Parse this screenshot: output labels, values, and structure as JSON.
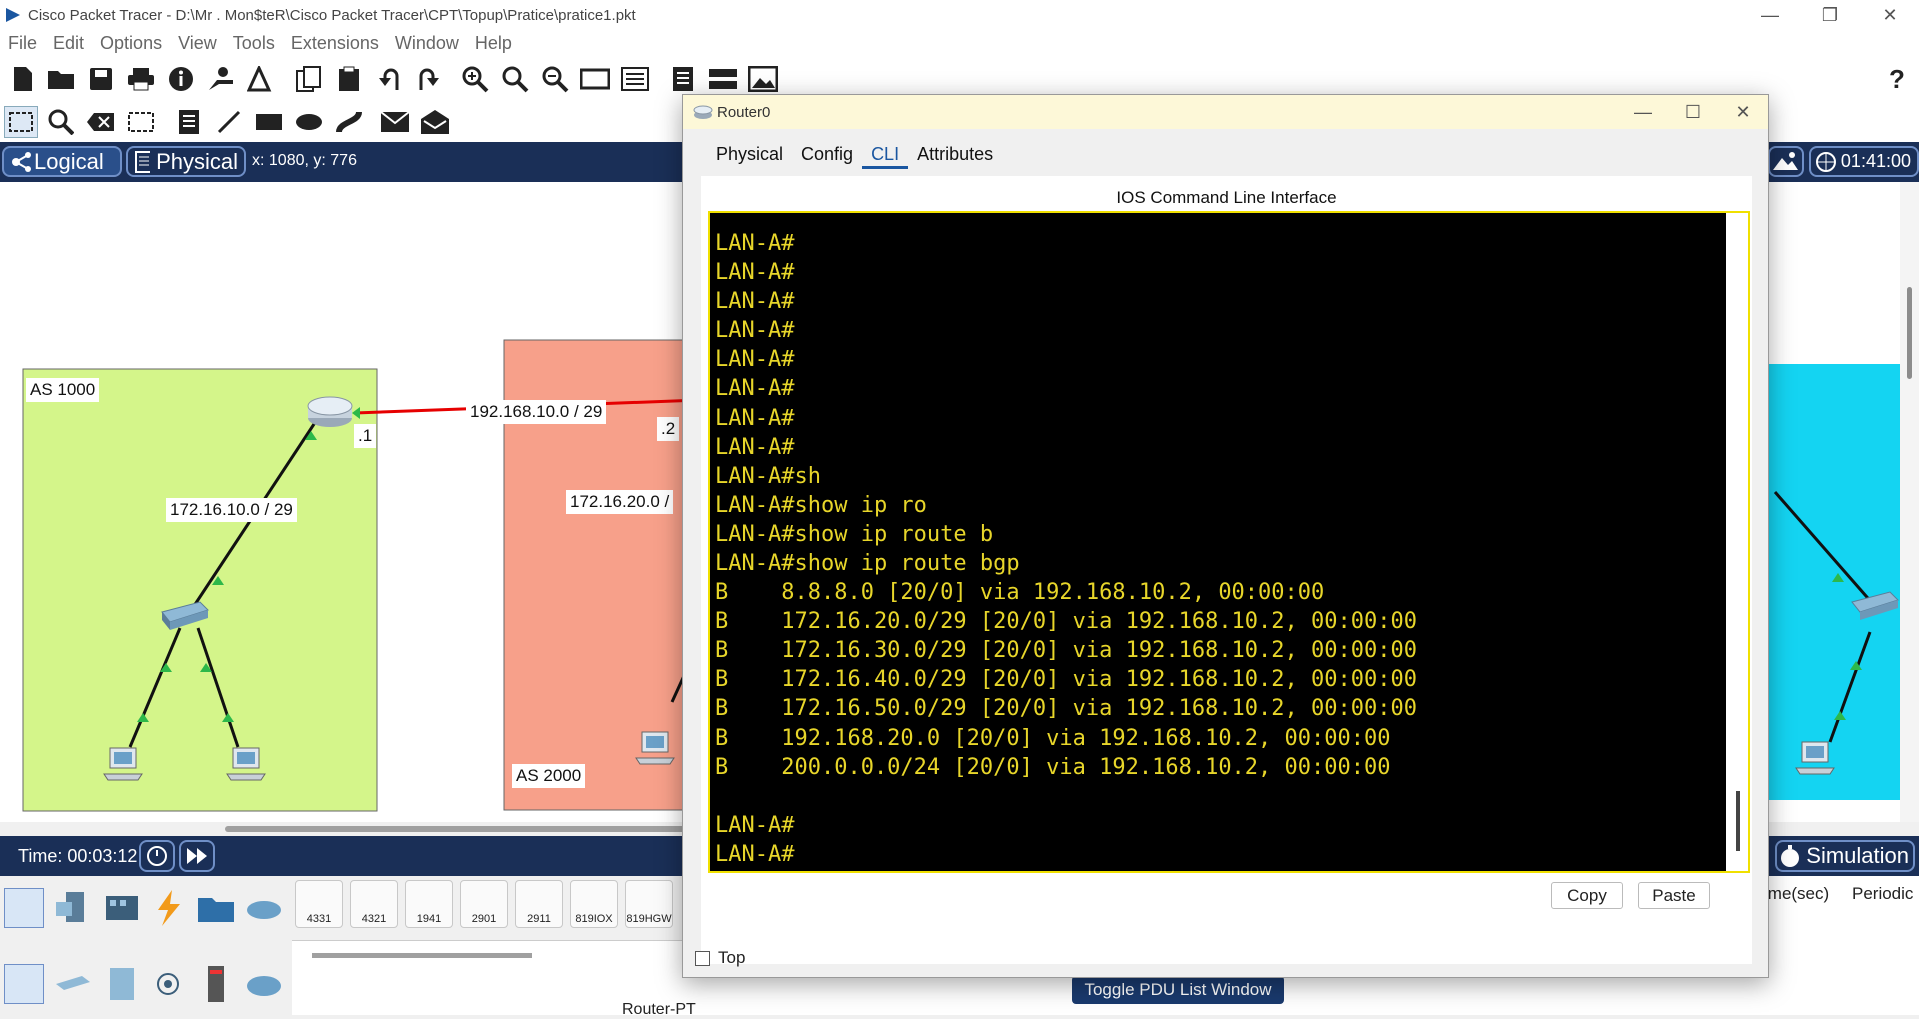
{
  "app": {
    "title": "Cisco Packet Tracer - D:\\Mr . Mon$teR\\Cisco Packet Tracer\\CPT\\Topup\\Pratice\\pratice1.pkt"
  },
  "menu": [
    "File",
    "Edit",
    "Options",
    "View",
    "Tools",
    "Extensions",
    "Window",
    "Help"
  ],
  "viewbar": {
    "logical": "Logical",
    "physical": "Physical",
    "coords": "x: 1080, y: 776",
    "clock": "01:41:00"
  },
  "topology": {
    "as1000": "AS 1000",
    "as2000": "AS 2000",
    "link_wan": "192.168.10.0 / 29",
    "link_lan_a": "172.16.10.0 / 29",
    "link_lan_b": "172.16.20.0 /",
    "ip_r0": ".1",
    "ip_r1": ".2",
    "colors": {
      "as1000": "#d4f58a",
      "as2000": "#f7a08a",
      "as3000": "#14d4f2",
      "wan_link": "#e60000"
    }
  },
  "statusbar": {
    "time": "Time: 00:03:12",
    "simulation": "Simulation",
    "col_time": "ime(sec)",
    "col_periodic": "Periodic",
    "toggle_pdu": "Toggle PDU List Window"
  },
  "palette": {
    "models": [
      "4331",
      "4321",
      "1941",
      "2901",
      "2911",
      "819IOX",
      "819HGW"
    ],
    "selected_label": "Router-PT"
  },
  "cli_window": {
    "title": "Router0",
    "tabs": [
      "Physical",
      "Config",
      "CLI",
      "Attributes"
    ],
    "active_tab": "CLI",
    "heading": "IOS Command Line Interface",
    "terminal_lines": [
      "LAN-A#",
      "LAN-A#",
      "LAN-A#",
      "LAN-A#",
      "LAN-A#",
      "LAN-A#",
      "LAN-A#",
      "LAN-A#",
      "LAN-A#sh",
      "LAN-A#show ip ro",
      "LAN-A#show ip route b",
      "LAN-A#show ip route bgp",
      "B    8.8.8.0 [20/0] via 192.168.10.2, 00:00:00",
      "B    172.16.20.0/29 [20/0] via 192.168.10.2, 00:00:00",
      "B    172.16.30.0/29 [20/0] via 192.168.10.2, 00:00:00",
      "B    172.16.40.0/29 [20/0] via 192.168.10.2, 00:00:00",
      "B    172.16.50.0/29 [20/0] via 192.168.10.2, 00:00:00",
      "B    192.168.20.0 [20/0] via 192.168.10.2, 00:00:00",
      "B    200.0.0.0/24 [20/0] via 192.168.10.2, 00:00:00",
      "",
      "LAN-A#",
      "LAN-A#"
    ],
    "copy": "Copy",
    "paste": "Paste",
    "top_label": "Top",
    "terminal_color": "#e8d62a"
  }
}
